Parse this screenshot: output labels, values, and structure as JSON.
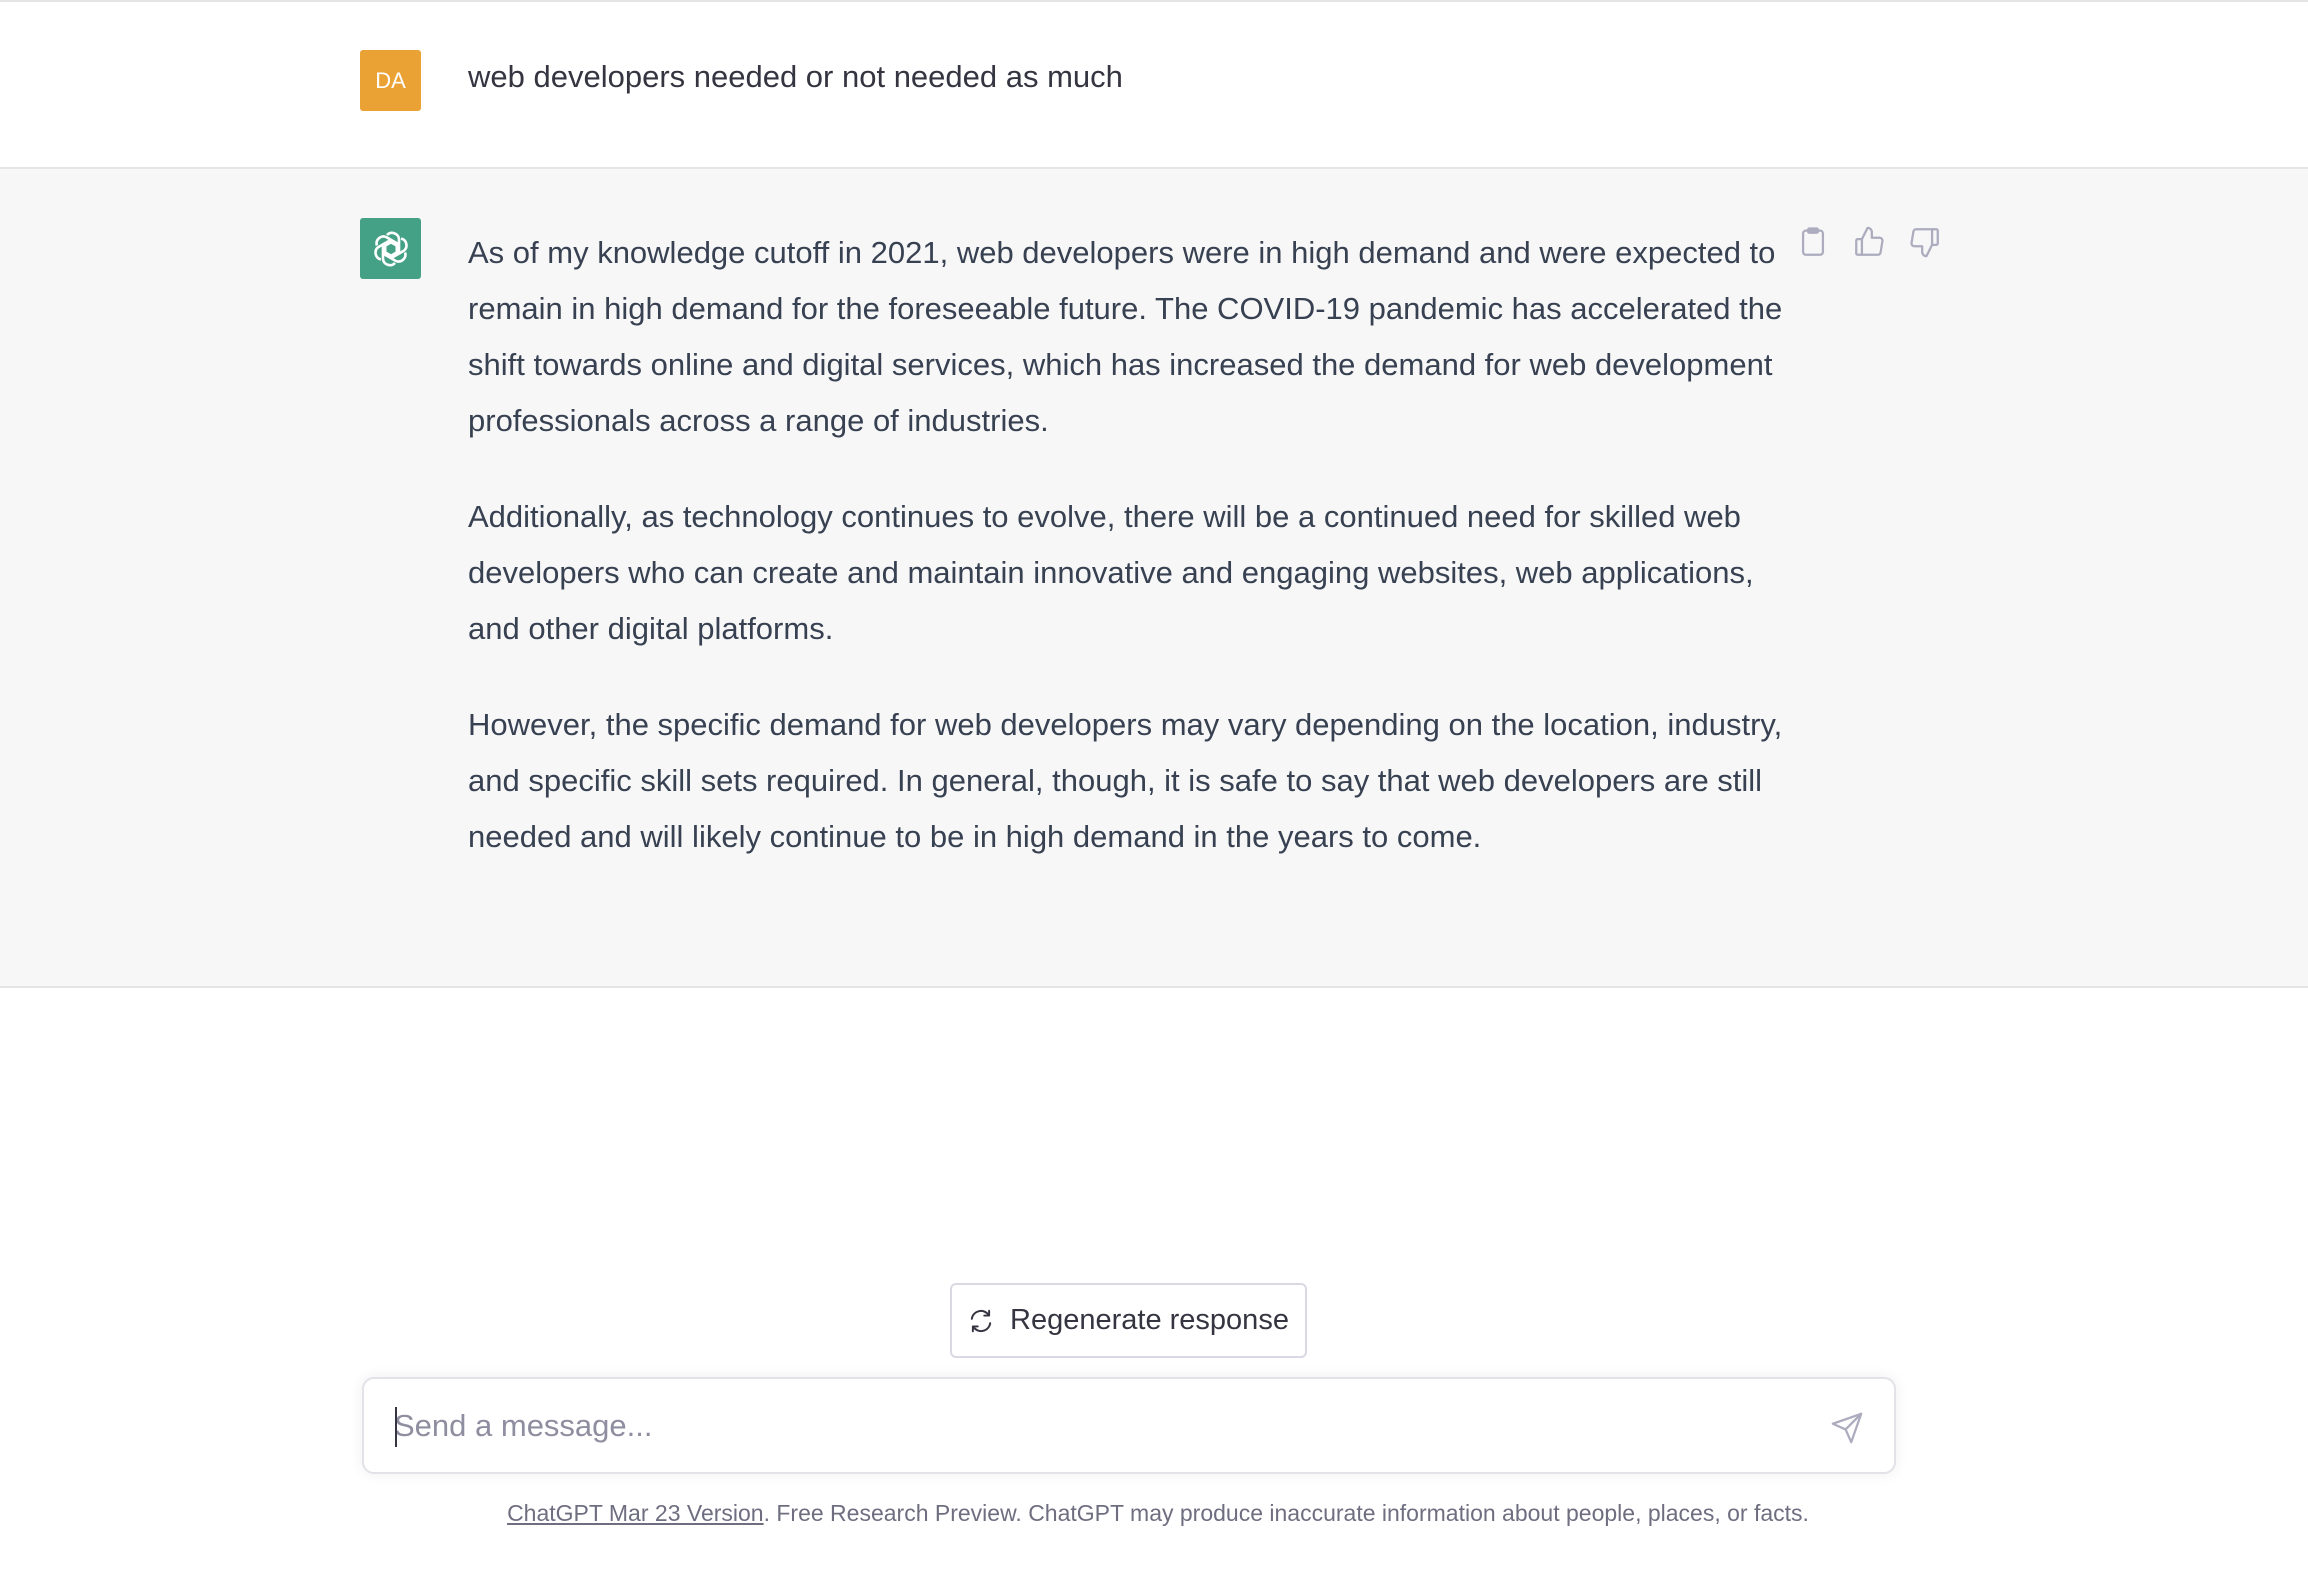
{
  "user_message": {
    "avatar_initials": "DA",
    "avatar_color": "#eaa234",
    "text": "web developers needed or not needed as much"
  },
  "assistant_message": {
    "avatar_icon": "openai-logo-icon",
    "avatar_color": "#45a186",
    "paragraphs": [
      "As of my knowledge cutoff in 2021, web developers were in high demand and were expected to remain in high demand for the foreseeable future. The COVID-19 pandemic has accelerated the shift towards online and digital services, which has increased the demand for web development professionals across a range of industries.",
      "Additionally, as technology continues to evolve, there will be a continued need for skilled web developers who can create and maintain innovative and engaging websites, web applications, and other digital platforms.",
      "However, the specific demand for web developers may vary depending on the location, industry, and specific skill sets required. In general, though, it is safe to say that web developers are still needed and will likely continue to be in high demand in the years to come."
    ],
    "actions": [
      "copy-icon",
      "thumbs-up-icon",
      "thumbs-down-icon"
    ]
  },
  "regenerate_button": {
    "label": "Regenerate response",
    "icon": "refresh-icon"
  },
  "composer": {
    "placeholder": "Send a message...",
    "value": "",
    "send_icon": "send-icon"
  },
  "footer": {
    "link_text": "ChatGPT Mar 23 Version",
    "text": ". Free Research Preview. ChatGPT may produce inaccurate information about people, places, or facts."
  },
  "colors": {
    "assistant_row_bg": "#f7f7f8",
    "text": "#374151",
    "muted": "#6e6e80"
  }
}
